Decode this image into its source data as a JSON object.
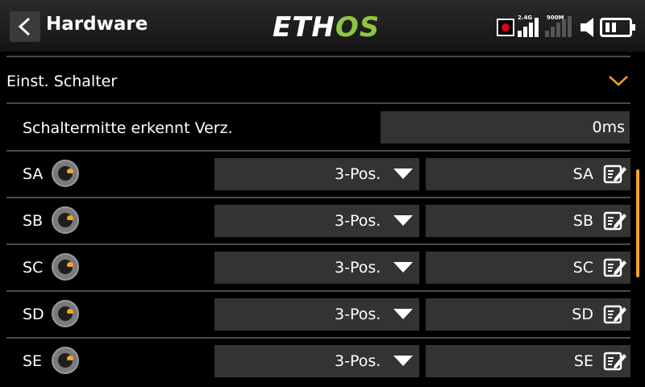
{
  "header": {
    "title": "Hardware",
    "logo_part1": "ETH",
    "logo_part2": "OS",
    "signal_2g4_label": "2.4G",
    "signal_900m_label": "900M"
  },
  "colors": {
    "accent": "#f5a623",
    "logo_green": "#8dc63f",
    "record_red": "#e0001a",
    "field_bg": "#333333"
  },
  "section": {
    "label": "Einst. Schalter",
    "expanded": true
  },
  "delay": {
    "label": "Schaltermitte erkennt Verz.",
    "value": "0ms"
  },
  "switches": [
    {
      "name": "SA",
      "type": "3-Pos.",
      "display_name": "SA"
    },
    {
      "name": "SB",
      "type": "3-Pos.",
      "display_name": "SB"
    },
    {
      "name": "SC",
      "type": "3-Pos.",
      "display_name": "SC"
    },
    {
      "name": "SD",
      "type": "3-Pos.",
      "display_name": "SD"
    },
    {
      "name": "SE",
      "type": "3-Pos.",
      "display_name": "SE"
    }
  ],
  "icons": {
    "back": "chevron-left-icon",
    "record": "record-icon",
    "signal": "signal-bars-icon",
    "speaker": "speaker-icon",
    "battery": "battery-icon",
    "expand": "chevron-down-icon",
    "switch": "switch-knob-icon",
    "dropdown": "triangle-down-icon",
    "edit": "edit-icon"
  }
}
